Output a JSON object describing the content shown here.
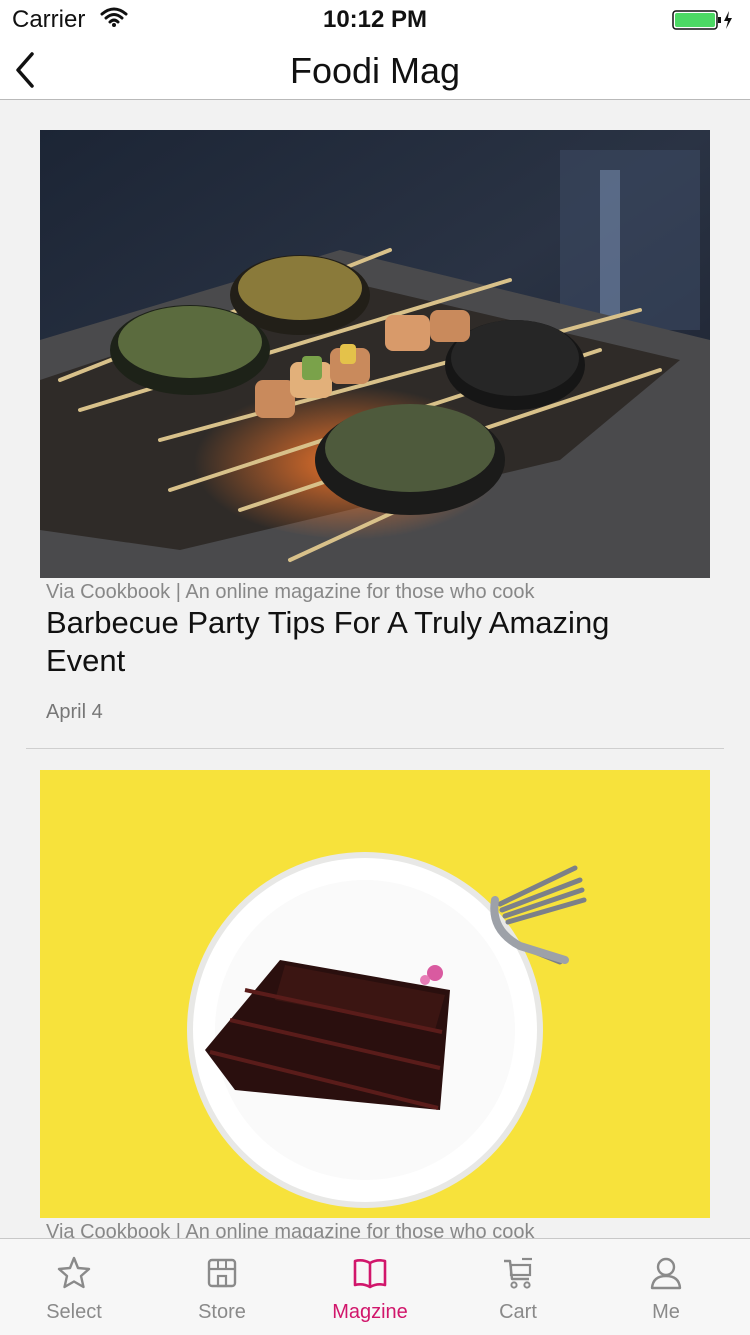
{
  "status_bar": {
    "carrier": "Carrier",
    "time": "10:12 PM"
  },
  "nav": {
    "title": "Foodi Mag"
  },
  "articles": [
    {
      "source": "Via Cookbook | An online magazine for those who cook",
      "title": "Barbecue Party Tips For A Truly Amazing Event",
      "date": "April 4"
    },
    {
      "source": "Via Cookbook | An online magazine for those who cook"
    }
  ],
  "tab_bar": {
    "tabs": [
      {
        "label": "Select",
        "icon": "star-icon"
      },
      {
        "label": "Store",
        "icon": "store-icon"
      },
      {
        "label": "Magzine",
        "icon": "book-icon"
      },
      {
        "label": "Cart",
        "icon": "cart-icon"
      },
      {
        "label": "Me",
        "icon": "person-icon"
      }
    ],
    "active_index": 2
  },
  "colors": {
    "accent": "#d1166b",
    "inactive": "#8a8a8a",
    "battery": "#4cd964",
    "cake_background": "#f7e23b"
  }
}
